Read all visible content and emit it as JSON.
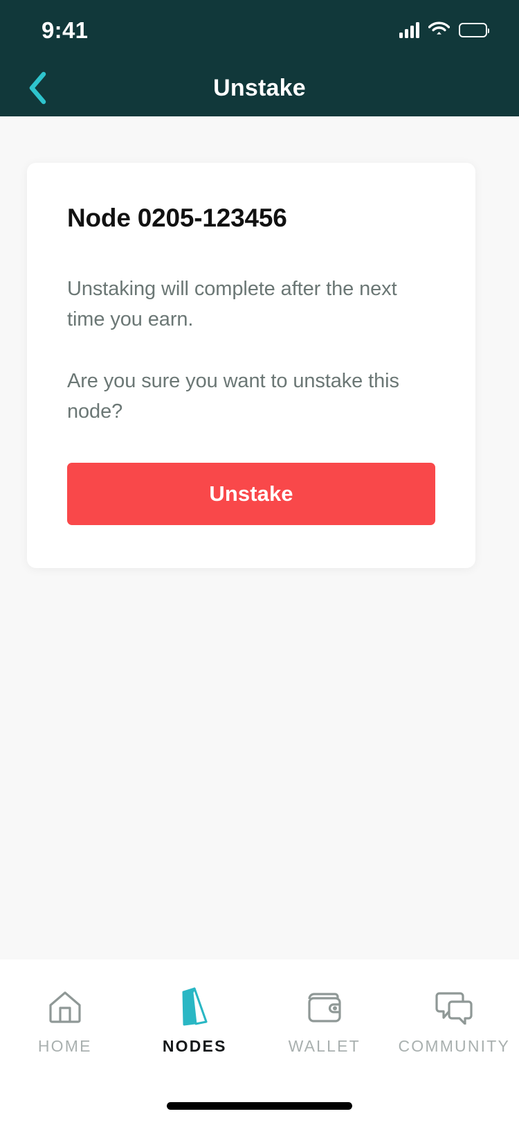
{
  "status_bar": {
    "time": "9:41",
    "signal_icon": "cellular-signal-icon",
    "wifi_icon": "wifi-icon",
    "battery_icon": "battery-full-icon"
  },
  "header": {
    "title": "Unstake",
    "back_icon": "chevron-left-icon",
    "background_color": "#11383a",
    "accent_color": "#2ec4cd"
  },
  "card": {
    "title": "Node 0205-123456",
    "paragraph_1": "Unstaking will complete after the next time you earn.",
    "paragraph_2": "Are you sure you want to unstake this node?",
    "action_label": "Unstake",
    "action_color": "#f9484a"
  },
  "tabbar": {
    "items": [
      {
        "label": "HOME",
        "icon": "home-icon",
        "active": false
      },
      {
        "label": "NODES",
        "icon": "node-monolith-icon",
        "active": true
      },
      {
        "label": "WALLET",
        "icon": "wallet-icon",
        "active": false
      },
      {
        "label": "COMMUNITY",
        "icon": "chat-bubbles-icon",
        "active": false
      }
    ],
    "active_color": "#2ab7c4",
    "inactive_color": "#a9b0af"
  }
}
